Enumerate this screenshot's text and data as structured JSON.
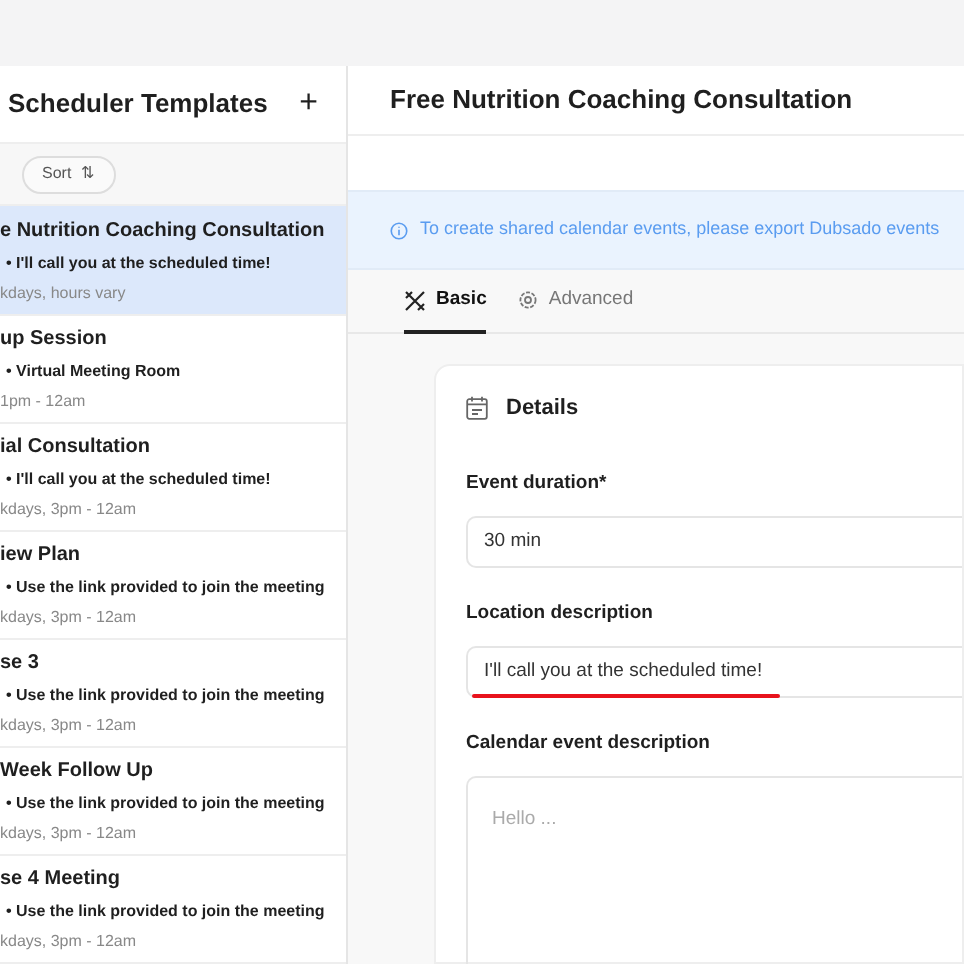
{
  "sidebar": {
    "title": "Scheduler Templates",
    "add_button": "+",
    "sort_button": {
      "label": "Sort",
      "icon": "⇅"
    },
    "items": [
      {
        "title": "e Nutrition Coaching Consultation",
        "location": "• I'll call you at the scheduled time!",
        "hours": "kdays, hours vary",
        "selected": true
      },
      {
        "title": "up Session",
        "location": "• Virtual Meeting Room",
        "hours": "1pm - 12am",
        "selected": false
      },
      {
        "title": "ial Consultation",
        "location": "• I'll call you at the scheduled time!",
        "hours": "kdays, 3pm - 12am",
        "selected": false
      },
      {
        "title": "iew Plan",
        "location": "• Use the link provided to join the meeting",
        "hours": "kdays, 3pm - 12am",
        "selected": false
      },
      {
        "title": "se 3",
        "location": "• Use the link provided to join the meeting",
        "hours": "kdays, 3pm - 12am",
        "selected": false
      },
      {
        "title": "Week Follow Up",
        "location": "• Use the link provided to join the meeting",
        "hours": "kdays, 3pm - 12am",
        "selected": false
      },
      {
        "title": "se 4 Meeting",
        "location": "• Use the link provided to join the meeting",
        "hours": "kdays, 3pm - 12am",
        "selected": false
      }
    ]
  },
  "main": {
    "title": "Free Nutrition Coaching Consultation",
    "banner": "To create shared calendar events, please export Dubsado events",
    "tabs": [
      {
        "label": "Basic",
        "selected": true
      },
      {
        "label": "Advanced",
        "selected": false
      }
    ],
    "card": {
      "title": "Details",
      "fields": [
        {
          "kind": "input",
          "label": "Event duration*",
          "value": "30 min",
          "underlined": false
        },
        {
          "kind": "input",
          "label": "Location description",
          "value": "I'll call you at the scheduled time!",
          "underlined": true
        },
        {
          "kind": "textarea",
          "label": "Calendar event description",
          "placeholder": "Hello ..."
        }
      ]
    }
  }
}
